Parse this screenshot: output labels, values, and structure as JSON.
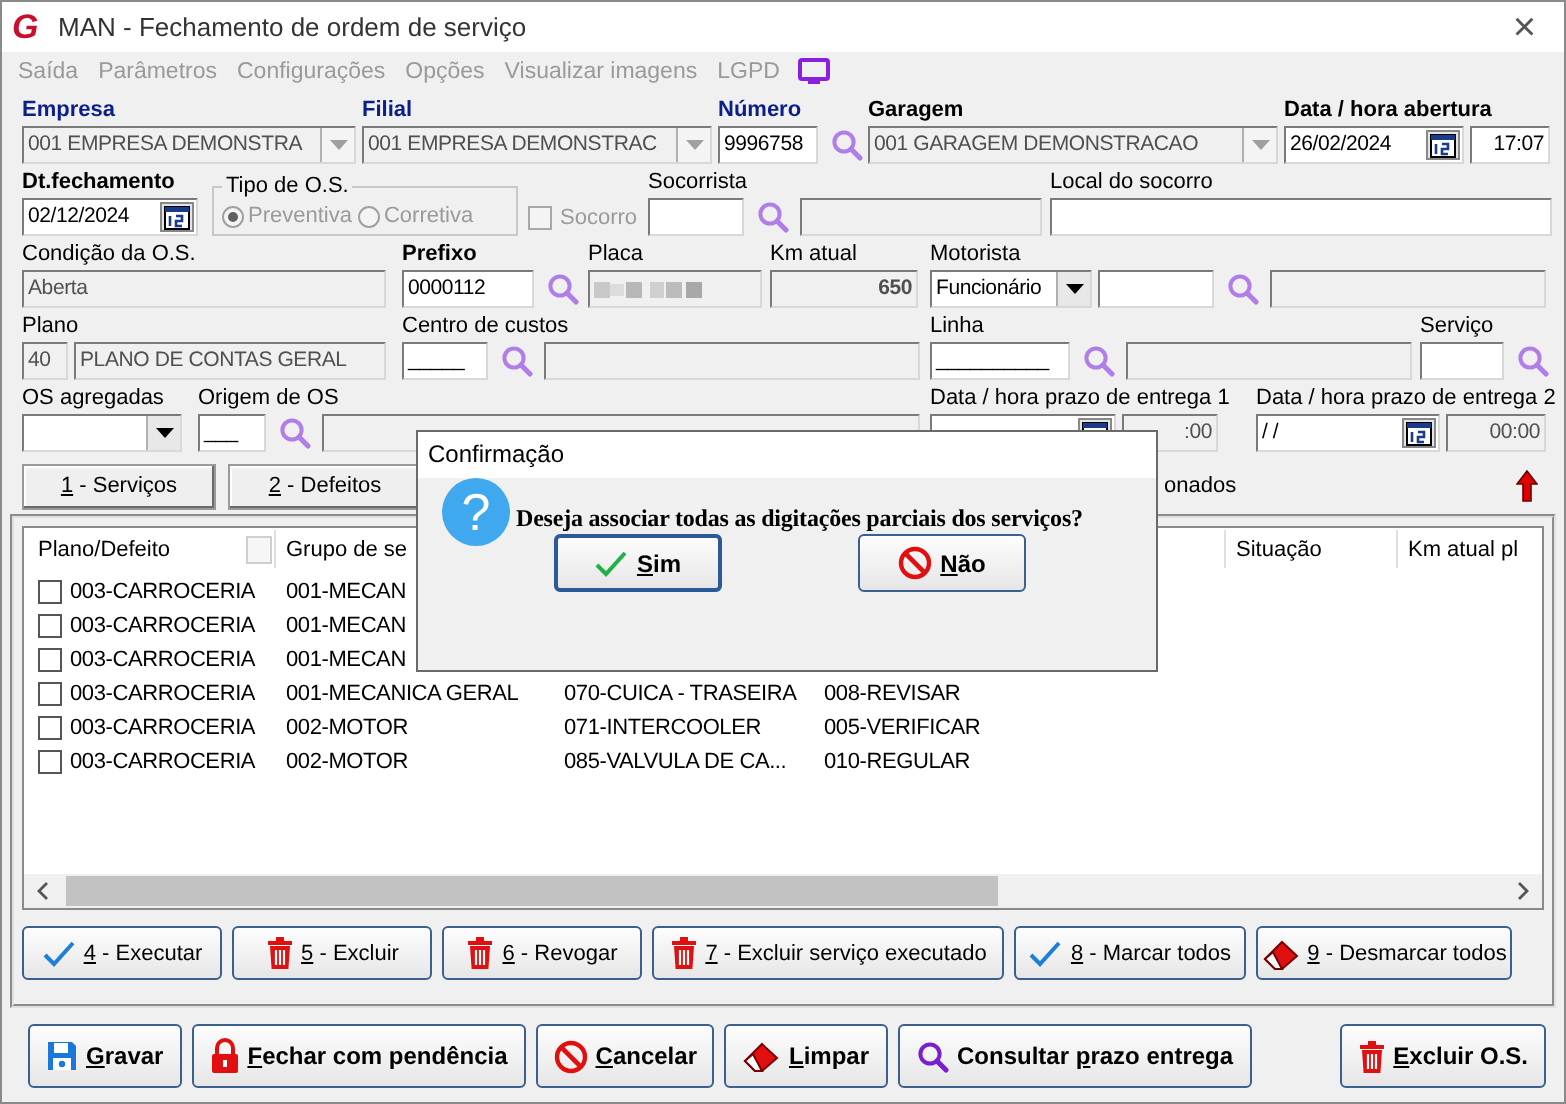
{
  "window": {
    "logo": "G",
    "title": "MAN - Fechamento de ordem de serviço",
    "close": "×"
  },
  "menu": [
    {
      "label": "Saída",
      "disabled": true
    },
    {
      "label": "Parâmetros",
      "disabled": true
    },
    {
      "label": "Configurações",
      "disabled": true
    },
    {
      "label": "Opções",
      "disabled": true
    },
    {
      "label": "Visualizar imagens",
      "disabled": true
    },
    {
      "label": "LGPD",
      "disabled": true
    }
  ],
  "form_rows": [
    [
      {
        "label": {
          "text": "Empresa",
          "kind": "required"
        },
        "controls": [
          {
            "kind": "combo",
            "value": "001 EMPRESA DEMONSTRA",
            "disabled": true
          }
        ]
      },
      {
        "label": {
          "text": "Filial",
          "kind": "required"
        },
        "controls": [
          {
            "kind": "combo",
            "value": "001 EMPRESA DEMONSTRAC",
            "disabled": true
          }
        ]
      },
      {
        "label": {
          "text": "Número",
          "kind": "required"
        },
        "controls": [
          {
            "kind": "text",
            "value": "9996758",
            "disabled": false
          },
          {
            "kind": "search"
          }
        ]
      },
      {
        "label": {
          "text": "Garagem",
          "kind": "bold"
        },
        "controls": [
          {
            "kind": "combo",
            "value": "001 GARAGEM DEMONSTRACAO",
            "disabled": true
          }
        ]
      },
      {
        "label": {
          "text": "Data / hora abertura",
          "kind": "bold"
        },
        "controls": [
          {
            "kind": "date",
            "value": "26/02/2024",
            "disabled": false
          },
          {
            "kind": "time",
            "value": "17:07",
            "disabled": false
          }
        ]
      }
    ],
    [
      {
        "label": {
          "text": "Dt.fechamento",
          "kind": "bold"
        },
        "controls": [
          {
            "kind": "date",
            "value": "02/12/2024",
            "disabled": false
          }
        ]
      },
      {
        "controls": [
          {
            "kind": "group",
            "title": "Tipo de O.S.",
            "disabled": true,
            "options": [
              {
                "label": "Preventiva",
                "selected": true
              },
              {
                "label": "Corretiva",
                "selected": false
              }
            ]
          }
        ]
      },
      {
        "controls": [
          {
            "kind": "checkbox",
            "label": "Socorro",
            "checked": false,
            "disabled": true
          }
        ]
      },
      {
        "label": {
          "text": "Socorrista",
          "kind": "normal"
        },
        "controls": [
          {
            "kind": "text",
            "disabled": false
          },
          {
            "kind": "search"
          },
          {
            "kind": "text",
            "disabled": true
          }
        ]
      },
      {
        "label": {
          "text": "Local do socorro",
          "kind": "normal"
        },
        "controls": [
          {
            "kind": "text",
            "disabled": false
          }
        ]
      }
    ],
    [
      {
        "label": {
          "text": "Condição da O.S.",
          "kind": "normal"
        },
        "controls": [
          {
            "kind": "text",
            "value": "Aberta",
            "disabled": true
          }
        ]
      },
      {
        "label": {
          "text": "Prefixo",
          "kind": "bold"
        },
        "controls": [
          {
            "kind": "text",
            "value": "0000112",
            "disabled": false
          },
          {
            "kind": "search"
          }
        ]
      },
      {
        "label": {
          "text": "Placa",
          "kind": "normal"
        },
        "controls": [
          {
            "kind": "blurred",
            "disabled": true
          }
        ]
      },
      {
        "label": {
          "text": "Km atual",
          "kind": "normal"
        },
        "controls": [
          {
            "kind": "number",
            "value": "650",
            "disabled": true
          }
        ]
      },
      {
        "label": {
          "text": "Motorista",
          "kind": "normal"
        },
        "controls": [
          {
            "kind": "combo",
            "value": "Funcionário",
            "disabled": false
          },
          {
            "kind": "text",
            "disabled": false
          },
          {
            "kind": "search"
          },
          {
            "kind": "text",
            "disabled": true
          }
        ]
      }
    ],
    [
      {
        "label": {
          "text": "Plano",
          "kind": "normal"
        },
        "controls": [
          {
            "kind": "text",
            "value": "40",
            "disabled": true
          },
          {
            "kind": "text",
            "value": "PLANO DE CONTAS GERAL",
            "disabled": true
          }
        ]
      },
      {
        "label": {
          "text": "Centro de custos",
          "kind": "normal"
        },
        "controls": [
          {
            "kind": "text",
            "value": "_____",
            "disabled": false
          },
          {
            "kind": "search"
          },
          {
            "kind": "text",
            "disabled": true
          }
        ]
      },
      {
        "label": {
          "text": "Linha",
          "kind": "normal"
        },
        "controls": [
          {
            "kind": "text",
            "value": "__________",
            "disabled": false
          },
          {
            "kind": "search"
          },
          {
            "kind": "text",
            "disabled": true
          }
        ]
      },
      {
        "label": {
          "text": "Serviço",
          "kind": "normal"
        },
        "controls": [
          {
            "kind": "text",
            "disabled": false
          },
          {
            "kind": "search"
          }
        ]
      }
    ],
    [
      {
        "label": {
          "text": "OS agregadas",
          "kind": "normal"
        },
        "controls": [
          {
            "kind": "combo",
            "disabled": false
          }
        ]
      },
      {
        "label": {
          "text": "Origem de OS",
          "kind": "normal"
        },
        "controls": [
          {
            "kind": "text",
            "value": "___",
            "disabled": false
          },
          {
            "kind": "search"
          },
          {
            "kind": "text",
            "disabled": true
          }
        ]
      },
      {
        "label": {
          "text": "Data / hora prazo de entrega 1",
          "kind": "normal"
        },
        "controls": [
          {
            "kind": "date",
            "disabled": false
          },
          {
            "kind": "time",
            "value": ":00",
            "disabled": true
          }
        ]
      },
      {
        "label": {
          "text": "Data / hora prazo de entrega 2",
          "kind": "normal"
        },
        "controls": [
          {
            "kind": "date",
            "value": " /  /",
            "disabled": false
          },
          {
            "kind": "time",
            "value": "00:00",
            "disabled": true
          }
        ]
      }
    ]
  ],
  "sections": [
    {
      "hotkey": "1",
      "suffix": " - Serviços"
    },
    {
      "hotkey": "2",
      "suffix": " - Defeitos"
    }
  ],
  "partial_label": "onados",
  "list": {
    "columns": [
      "Plano/Defeito",
      "Grupo de se",
      null,
      null,
      "Situação",
      "Km atual pl"
    ],
    "rows": [
      {
        "checked": false,
        "cells": [
          "003-CARROCERIA",
          "001-MECAN",
          null,
          null
        ]
      },
      {
        "checked": false,
        "cells": [
          "003-CARROCERIA",
          "001-MECAN",
          null,
          null
        ]
      },
      {
        "checked": false,
        "cells": [
          "003-CARROCERIA",
          "001-MECAN",
          null,
          null
        ]
      },
      {
        "checked": false,
        "cells": [
          "003-CARROCERIA",
          "001-MECANICA GERAL",
          "070-CUICA - TRASEIRA",
          "008-REVISAR"
        ]
      },
      {
        "checked": false,
        "cells": [
          "003-CARROCERIA",
          "002-MOTOR",
          "071-INTERCOOLER",
          "005-VERIFICAR"
        ]
      },
      {
        "checked": false,
        "cells": [
          "003-CARROCERIA",
          "002-MOTOR",
          "085-VALVULA DE CA...",
          "010-REGULAR"
        ]
      }
    ]
  },
  "actions": [
    {
      "hotkey": "4",
      "suffix": " - Executar",
      "kind": "check"
    },
    {
      "hotkey": "5",
      "suffix": " - Excluir",
      "kind": "trash"
    },
    {
      "hotkey": "6",
      "suffix": " - Revogar",
      "kind": "trash"
    },
    {
      "hotkey": "7",
      "suffix": " - Excluir serviço executado",
      "kind": "trash"
    },
    {
      "hotkey": "8",
      "suffix": " - Marcar todos",
      "kind": "check"
    },
    {
      "hotkey": "9",
      "suffix": " - Desmarcar todos",
      "kind": "eraser"
    }
  ],
  "footer_buttons": [
    {
      "hotkey": "G",
      "suffix": "ravar",
      "kind": "save"
    },
    {
      "hotkey": "F",
      "suffix": "echar com pendência",
      "kind": "lock"
    },
    {
      "hotkey": "C",
      "suffix": "ancelar",
      "kind": "cancel"
    },
    {
      "hotkey": "L",
      "suffix": "impar",
      "kind": "eraser"
    },
    {
      "prefix": "Consultar ",
      "hotkey": "p",
      "suffix": "razo entrega",
      "kind": "search"
    },
    {
      "hotkey": "E",
      "suffix": "xcluir O.S.",
      "kind": "trash"
    }
  ],
  "dialog": {
    "title": "Confirmação",
    "icon": "?",
    "message": "Deseja associar todas as digitações parciais dos serviços?",
    "buttons": [
      {
        "hotkey": "S",
        "suffix": "im",
        "kind": "check",
        "focused": true
      },
      {
        "hotkey": "N",
        "suffix": "ão",
        "kind": "cancel",
        "focused": false
      }
    ]
  }
}
